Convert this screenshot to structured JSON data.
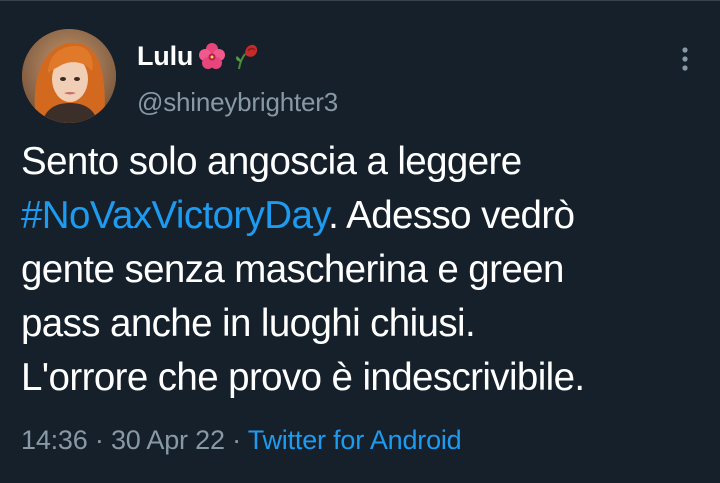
{
  "author": {
    "display_name": "Lulu",
    "name_emojis": [
      "hibiscus-icon",
      "wilted-rose-icon"
    ],
    "handle": "@shineybrighter3"
  },
  "tweet": {
    "line1": "Sento solo angoscia a leggere",
    "hashtag": "#NoVaxVictoryDay",
    "line2_rest": ". Adesso vedrò",
    "line3": "gente senza mascherina e green",
    "line4": "pass anche in luoghi chiusi.",
    "line5": "L'orrore che provo è indescrivibile."
  },
  "meta": {
    "time": "14:36",
    "sep1": " · ",
    "date": "30 Apr 22",
    "sep2": " · ",
    "source": "Twitter for Android"
  },
  "colors": {
    "background": "#15202b",
    "link": "#1d9bf0",
    "secondary_text": "#8899a6"
  }
}
